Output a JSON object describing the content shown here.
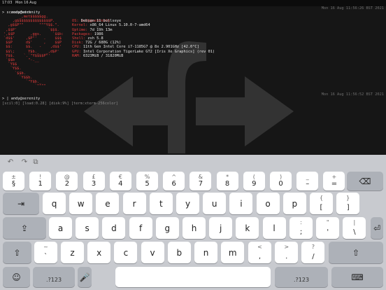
{
  "status_bar": {
    "time": "17:03",
    "date": "Mon 16 Aug"
  },
  "terminal": {
    "prompt_user": "andy@serenity",
    "timestamp_1": "Mon 16 Aug 11:56:26 BST 2021",
    "cmd_1": "> screenfetch",
    "fetch_user": "andy@serenity",
    "info": [
      {
        "key": "OS:",
        "val": "Debian 11 bullseye"
      },
      {
        "key": "Kernel:",
        "val": "x86_64 Linux 5.10.0-7-amd64"
      },
      {
        "key": "Uptime:",
        "val": "7d 19h 13m"
      },
      {
        "key": "Packages:",
        "val": "1986"
      },
      {
        "key": "Shell:",
        "val": "zsh 5.8"
      },
      {
        "key": "Disk:",
        "val": "72G / 680G (12%)"
      },
      {
        "key": "CPU:",
        "val": "11th Gen Intel Core i7-1185G7 @ 8x 2.901GHz [42.0°C]"
      },
      {
        "key": "GPU:",
        "val": "Intel Corporation TigerLake GT2 [Iris Xe Graphics] (rev 01)"
      },
      {
        "key": "RAM:",
        "val": "6323MiB / 31820MiB"
      }
    ],
    "logo": [
      "       _,met$$$$$gg.",
      "    ,g$$$$$$$$$$$$$$$P.",
      "  ,g$$P\"\"       \"\"\"Y$$.\".",
      " ,$$P'              `$$$.",
      "',$$P       ,ggs.     `$$b:",
      "`d$$'     ,$P\"'   .    $$$",
      " $$P      d$'     ,    $$P",
      " $$:      $$.   -    ,d$$'",
      " $$\\;      Y$b._   _,d$P'",
      " Y$$.    `.`\"Y$$$$P\"'",
      " `$$b      \"-.__",
      "  `Y$$",
      "   `Y$$.",
      "     `$$b.",
      "       `Y$$b.",
      "          `\"Y$b._",
      "              `\"\"\"\""
    ],
    "prompt_user_2": "andy@serenity",
    "timestamp_2": "Mon 16 Aug 11:56:52 BST 2021",
    "cmd_2": "> |",
    "tmux_bar": "[scil:0] [load:0.28] [disk:9%] [term:xterm-256color]"
  },
  "toolbar": {
    "undo": "↶",
    "redo": "↷",
    "paste": "⧉"
  },
  "keyboard": {
    "row1": [
      {
        "top": "±",
        "bot": "§"
      },
      {
        "top": "!",
        "bot": "1"
      },
      {
        "top": "@",
        "bot": "2"
      },
      {
        "top": "£",
        "bot": "3"
      },
      {
        "top": "€",
        "bot": "4"
      },
      {
        "top": "%",
        "bot": "5"
      },
      {
        "top": "^",
        "bot": "6"
      },
      {
        "top": "&",
        "bot": "7"
      },
      {
        "top": "*",
        "bot": "8"
      },
      {
        "top": "(",
        "bot": "9"
      },
      {
        "top": ")",
        "bot": "0"
      },
      {
        "top": "_",
        "bot": "–"
      },
      {
        "top": "+",
        "bot": "="
      }
    ],
    "delete_icon": "⌫",
    "tab_icon": "⇥",
    "row2": [
      "q",
      "w",
      "e",
      "r",
      "t",
      "y",
      "u",
      "i",
      "o",
      "p"
    ],
    "row2_extra": [
      {
        "top": "{",
        "bot": "["
      },
      {
        "top": "}",
        "bot": "]"
      }
    ],
    "caps_icon": "⇪",
    "row3": [
      "a",
      "s",
      "d",
      "f",
      "g",
      "h",
      "j",
      "k",
      "l"
    ],
    "row3_extra": [
      {
        "top": ":",
        "bot": ";"
      },
      {
        "top": "\"",
        "bot": "'"
      },
      {
        "top": "|",
        "bot": "\\"
      }
    ],
    "return_icon": "⏎",
    "shift_icon": "⇧",
    "row4_pre": {
      "top": "~",
      "bot": "`"
    },
    "row4": [
      "z",
      "x",
      "c",
      "v",
      "b",
      "n",
      "m"
    ],
    "row4_extra": [
      {
        "top": "<",
        "bot": ","
      },
      {
        "top": ">",
        "bot": "."
      },
      {
        "top": "?",
        "bot": "/"
      }
    ],
    "emoji_icon": "☺",
    "num_label": ".?123",
    "mic_icon": "🎤",
    "hide_icon": "⌨"
  }
}
